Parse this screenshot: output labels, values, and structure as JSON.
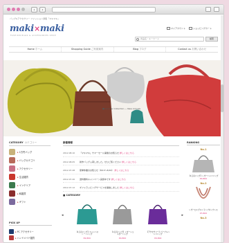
{
  "breadcrumb": "バッグ&アクセサリー ファッション通販「マキマキ」",
  "logo": {
    "left": "maki",
    "x": "×",
    "right": "maki"
  },
  "tagline": "FASHION  BAGS  &  ACCESSORIES  SHOP",
  "header_links": [
    "マイアカウント",
    "ショッピングカート"
  ],
  "search": {
    "placeholder": "商品名・キーワード",
    "button": "検索"
  },
  "global_nav": [
    {
      "label": "Home",
      "sub": "ホーム"
    },
    {
      "label": "Shopping Guide",
      "sub": "ご利用案内"
    },
    {
      "label": "Blog",
      "sub": "ブログ"
    },
    {
      "label": "Contact us",
      "sub": "お問い合わせ"
    }
  ],
  "hero": {
    "caption": "■Summer Collection ― New Arrivals"
  },
  "sidebar": {
    "head": "CATEGORY",
    "head_sub": "カテゴリー",
    "items": [
      {
        "label": "1万円バッグ",
        "color": "#c8b27a"
      },
      {
        "label": "バッグカテゴリ",
        "color": "#b86a5a"
      },
      {
        "label": "アクセサリー",
        "color": "#c96f84"
      },
      {
        "label": "生活雑貨",
        "color": "#c9362c"
      },
      {
        "label": "インテリア",
        "color": "#3c7a4d"
      },
      {
        "label": "和雑貨",
        "color": "#8a2d2d"
      },
      {
        "label": "ギフト",
        "color": "#7c6a9e"
      }
    ]
  },
  "news": {
    "head": "新着情報",
    "rows": [
      {
        "date": "2012.08.10",
        "text": "「マキマキ」サマーセール開催のお知らせ",
        "tag": "詳しくはこちら"
      },
      {
        "date": "2012.08.05",
        "text": "新作バッグ入荷しました。ぜひご覧ください",
        "tag": "詳しくはこちら"
      },
      {
        "date": "2012.07.28",
        "text": "夏季休業のお知らせ（8/13〜8/16）",
        "tag": "詳しくはこちら"
      },
      {
        "date": "2012.07.20",
        "text": "送料無料キャンペーン実施中です",
        "tag": "詳しくはこちら"
      },
      {
        "date": "2012.07.12",
        "text": "ギフトラッピングサービスを開始しました",
        "tag": "詳しくはこちら"
      }
    ]
  },
  "category_pick": {
    "head": "■ CATEGORY",
    "items": [
      {
        "title": "【1万円バッグ】キャンバストートバッグ",
        "price": "¥9,800"
      },
      {
        "title": "【1万円バッグ】レザーショルダーバッグ",
        "price": "¥9,800"
      },
      {
        "title": "【アクセサリー】パープルハンドバッグ",
        "price": "¥9,800"
      }
    ]
  },
  "ranking": {
    "head": "RANKING",
    "items": [
      {
        "num": "No.1",
        "title": "【1万円バッグ】レザーハンドバッグ",
        "price": "¥9,800"
      },
      {
        "num": "No.2",
        "title": "レザーロングストラップネックレス",
        "price": "¥3,800"
      },
      {
        "num": "No.3",
        "title": "",
        "price": ""
      }
    ]
  },
  "pickup": {
    "head": "PICK UP",
    "items": [
      {
        "label": "PC アクセサリー",
        "color": "#1f3b6e"
      },
      {
        "label": "ハンドメイド雑貨",
        "color": "#b83a3a"
      }
    ]
  },
  "colors": {
    "accent": "#e0417f",
    "logo": "#3a5fa0",
    "background": "#efd9e2"
  }
}
